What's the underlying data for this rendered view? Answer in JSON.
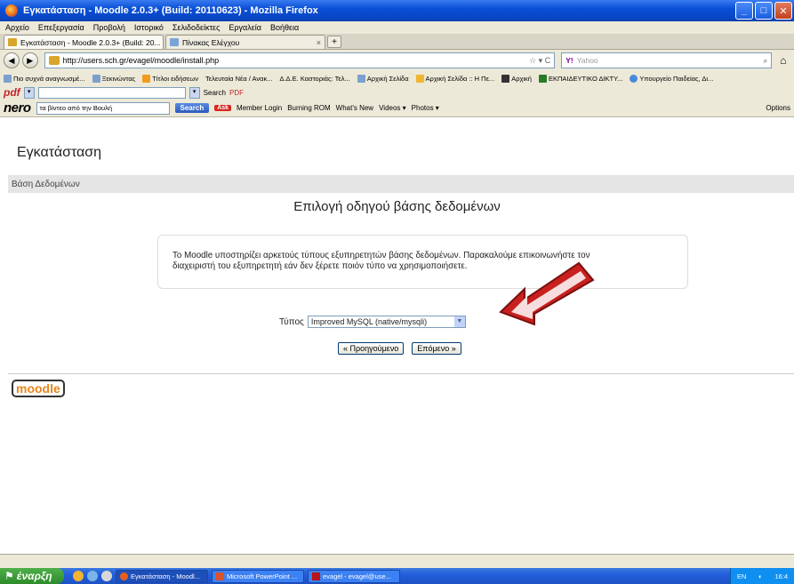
{
  "window": {
    "title": "Εγκατάσταση - Moodle 2.0.3+ (Build: 20110623) - Mozilla Firefox",
    "btn_min": "_",
    "btn_max": "□",
    "btn_close": "✕"
  },
  "menu": [
    "Αρχείο",
    "Επεξεργασία",
    "Προβολή",
    "Ιστορικό",
    "Σελιδοδείκτες",
    "Εργαλεία",
    "Βοήθεια"
  ],
  "tabs": [
    {
      "label": "Εγκατάσταση - Moodle 2.0.3+ (Build: 20...",
      "close": "×"
    },
    {
      "label": "Πίνακας Ελέγχου",
      "close": "×"
    }
  ],
  "new_tab": "+",
  "nav": {
    "back": "◀",
    "forward": "▶",
    "url": "http://users.sch.gr/evagel/moodle/install.php",
    "url_icons": "☆ ▾ C",
    "search_engine": "Y!",
    "search_placeholder": "Yahoo",
    "search_icon": "⌕",
    "home_icon": "⌂"
  },
  "bookmarks": [
    "Πιο συχνά αναγνωσμέ...",
    "Ξεκινώντας",
    "Τίτλοι ειδήσεων",
    "Τελευταία Νέα / Ανακ...",
    "Δ.Δ.Ε. Καστοριάς: Τελ...",
    "Αρχική Σελίδα",
    "Αρχική Σελίδα :: Η Πε...",
    "Αρχική",
    "ΕΚΠΑΙΔΕΥΤΙΚΟ ΔΙΚΤΥ...",
    "Υπουργείο Παιδείας, Δι..."
  ],
  "pdfbar": {
    "logo": "pdf",
    "search": "Search",
    "pdf": "PDF"
  },
  "nerobar": {
    "logo": "nero",
    "search_value": "τα βίντεο από την Βουλή",
    "search_btn": "Search",
    "ask": "Ask",
    "links": [
      "Member Login",
      "Burning ROM",
      "What's New",
      "Videos ▾",
      "Photos ▾"
    ],
    "options": "Options"
  },
  "page": {
    "site_heading": "Εγκατάσταση",
    "navbar": "Βάση Δεδομένων",
    "heading": "Επιλογή οδηγού βάσης δεδομένων",
    "info_line1": "Το Moodle υποστηρίζει αρκετούς τύπους εξυπηρετητών βάσης δεδομένων. Παρακαλούμε επικοινωνήστε τον",
    "info_line2": "διαχειριστή του εξυπηρετητή εάν δεν ξέρετε ποιόν τύπο να χρησιμοποιήσετε.",
    "type_label": "Τύπος",
    "type_value": "Improved MySQL (native/mysqli)",
    "prev_btn": "« Προηγούμενο",
    "next_btn": "Επόμενο »",
    "logo": "moodle"
  },
  "taskbar": {
    "start": "έναρξη",
    "buttons": [
      {
        "label": "Εγκατάσταση - Moodl..."
      },
      {
        "label": "Microsoft PowerPoint ..."
      },
      {
        "label": "evagel - evagel@use..."
      }
    ],
    "lang": "EN",
    "time": "16:4"
  },
  "colors": {
    "titlebar": "#0a4fd6",
    "arrow_fill": "#c8201e",
    "moodle_orange": "#e9851b"
  }
}
